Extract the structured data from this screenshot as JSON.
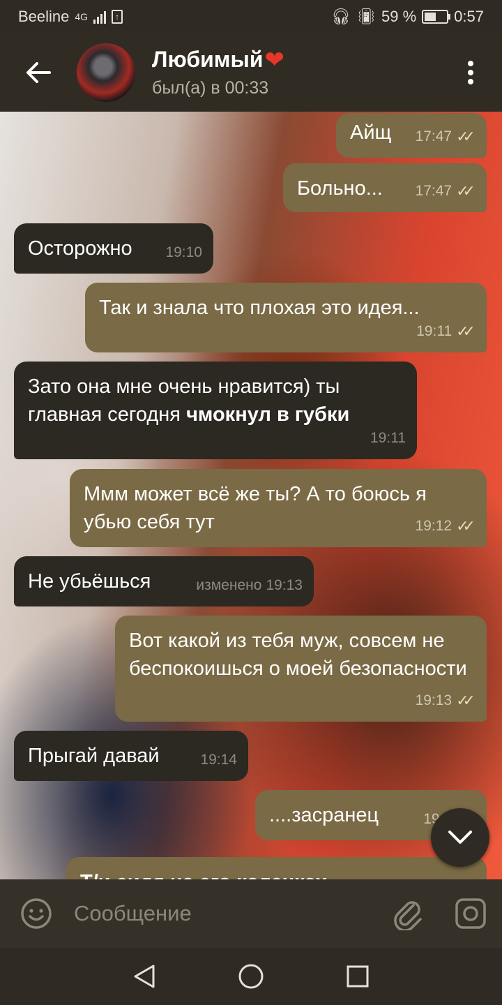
{
  "status_bar": {
    "carrier": "Beeline",
    "network": "4G",
    "battery_percent": "59 %",
    "time": "0:57"
  },
  "header": {
    "contact_name": "Любимый",
    "heart_emoji": "❤",
    "last_seen": "был(а) в 00:33"
  },
  "messages": [
    {
      "dir": "out",
      "text": "Айщ",
      "time": "17:47",
      "read": true
    },
    {
      "dir": "out",
      "text": "Больно...",
      "time": "17:47",
      "read": true
    },
    {
      "dir": "in",
      "text": "Осторожно",
      "time": "19:10"
    },
    {
      "dir": "out",
      "text": "Так и знала что плохая это идея...",
      "time": "19:11",
      "read": true
    },
    {
      "dir": "in",
      "text_plain": "Зато она мне очень нравится) ты главная сегодня ",
      "text_bold": "чмокнул в губки",
      "time": "19:11"
    },
    {
      "dir": "out",
      "text": "Ммм может всё же ты? А то боюсь я убью себя тут",
      "time": "19:12",
      "read": true
    },
    {
      "dir": "in",
      "text": "Не убьёшься",
      "edited": "изменено",
      "time": "19:13"
    },
    {
      "dir": "out",
      "text": "Вот какой из тебя муж, совсем не беспокоишься о моей безопасности",
      "time": "19:13",
      "read": true
    },
    {
      "dir": "in",
      "text": "Прыгай давай",
      "time": "19:14"
    },
    {
      "dir": "out",
      "text": "....засранец",
      "time": "19:1",
      "read": true
    },
    {
      "dir": "out",
      "text": "Т/и сидя на его коленках",
      "time": ""
    }
  ],
  "input": {
    "placeholder": "Сообщение"
  },
  "colors": {
    "outgoing_bubble": "#7a6a45",
    "incoming_bubble": "#2c2822",
    "header_bg": "#302c24",
    "accent_heart": "#e8362b"
  }
}
